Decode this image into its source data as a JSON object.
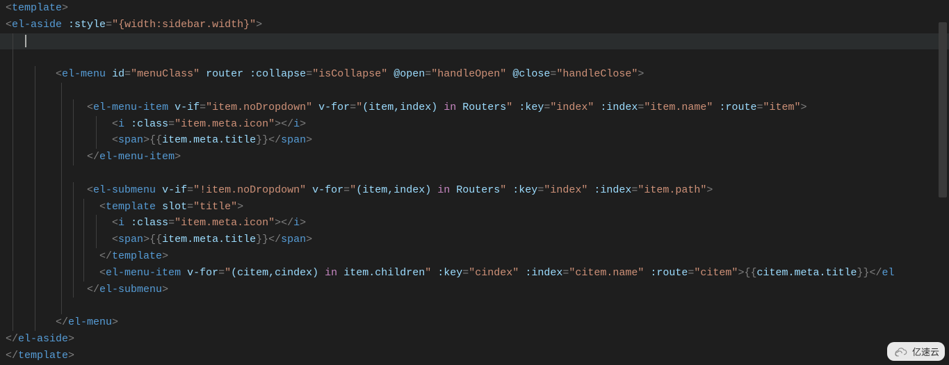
{
  "watermark": "亿速云",
  "lines": [
    {
      "guides": [],
      "segments": [
        {
          "t": "<",
          "c": "punct"
        },
        {
          "t": "template",
          "c": "tag"
        },
        {
          "t": ">",
          "c": "punct"
        }
      ]
    },
    {
      "guides": [],
      "segments": [
        {
          "t": "<",
          "c": "punct"
        },
        {
          "t": "el-aside",
          "c": "tag"
        },
        {
          "t": " ",
          "c": "txt"
        },
        {
          "t": ":style",
          "c": "attr"
        },
        {
          "t": "=",
          "c": "punct"
        },
        {
          "t": "\"{width:sidebar.width}\"",
          "c": "str"
        },
        {
          "t": ">",
          "c": "punct"
        }
      ]
    },
    {
      "guides": [
        "g1"
      ],
      "hl": true,
      "cursor": true,
      "segments": [
        {
          "t": "   ",
          "c": "txt"
        }
      ]
    },
    {
      "guides": [
        "g1"
      ],
      "segments": [
        {
          "t": "",
          "c": "txt"
        }
      ]
    },
    {
      "guides": [
        "g1",
        "g2"
      ],
      "segments": [
        {
          "t": "        ",
          "c": "txt"
        },
        {
          "t": "<",
          "c": "punct"
        },
        {
          "t": "el-menu",
          "c": "tag"
        },
        {
          "t": " ",
          "c": "txt"
        },
        {
          "t": "id",
          "c": "attr"
        },
        {
          "t": "=",
          "c": "punct"
        },
        {
          "t": "\"menuClass\"",
          "c": "str"
        },
        {
          "t": " ",
          "c": "txt"
        },
        {
          "t": "router",
          "c": "attr"
        },
        {
          "t": " ",
          "c": "txt"
        },
        {
          "t": ":collapse",
          "c": "attr"
        },
        {
          "t": "=",
          "c": "punct"
        },
        {
          "t": "\"isCollapse\"",
          "c": "str"
        },
        {
          "t": " ",
          "c": "txt"
        },
        {
          "t": "@open",
          "c": "attr"
        },
        {
          "t": "=",
          "c": "punct"
        },
        {
          "t": "\"handleOpen\"",
          "c": "str"
        },
        {
          "t": " ",
          "c": "txt"
        },
        {
          "t": "@close",
          "c": "attr"
        },
        {
          "t": "=",
          "c": "punct"
        },
        {
          "t": "\"handleClose\"",
          "c": "str"
        },
        {
          "t": ">",
          "c": "punct"
        }
      ]
    },
    {
      "guides": [
        "g1",
        "g2",
        "g3"
      ],
      "segments": [
        {
          "t": "",
          "c": "txt"
        }
      ]
    },
    {
      "guides": [
        "g1",
        "g2",
        "g3",
        "g4"
      ],
      "segments": [
        {
          "t": "             ",
          "c": "txt"
        },
        {
          "t": "<",
          "c": "punct"
        },
        {
          "t": "el-menu-item",
          "c": "tag"
        },
        {
          "t": " ",
          "c": "txt"
        },
        {
          "t": "v-if",
          "c": "attr"
        },
        {
          "t": "=",
          "c": "punct"
        },
        {
          "t": "\"item.noDropdown\"",
          "c": "str"
        },
        {
          "t": " ",
          "c": "txt"
        },
        {
          "t": "v-for",
          "c": "attr"
        },
        {
          "t": "=",
          "c": "punct"
        },
        {
          "t": "\"",
          "c": "str"
        },
        {
          "t": "(item,index) ",
          "c": "ident"
        },
        {
          "t": "in",
          "c": "key"
        },
        {
          "t": " Routers",
          "c": "ident"
        },
        {
          "t": "\"",
          "c": "str"
        },
        {
          "t": " ",
          "c": "txt"
        },
        {
          "t": ":key",
          "c": "attr"
        },
        {
          "t": "=",
          "c": "punct"
        },
        {
          "t": "\"index\"",
          "c": "str"
        },
        {
          "t": " ",
          "c": "txt"
        },
        {
          "t": ":index",
          "c": "attr"
        },
        {
          "t": "=",
          "c": "punct"
        },
        {
          "t": "\"item.name\"",
          "c": "str"
        },
        {
          "t": " ",
          "c": "txt"
        },
        {
          "t": ":route",
          "c": "attr"
        },
        {
          "t": "=",
          "c": "punct"
        },
        {
          "t": "\"item\"",
          "c": "str"
        },
        {
          "t": ">",
          "c": "punct"
        }
      ]
    },
    {
      "guides": [
        "g1",
        "g2",
        "g3",
        "g4",
        "g6"
      ],
      "segments": [
        {
          "t": "                 ",
          "c": "txt"
        },
        {
          "t": "<",
          "c": "punct"
        },
        {
          "t": "i",
          "c": "tag"
        },
        {
          "t": " ",
          "c": "txt"
        },
        {
          "t": ":class",
          "c": "attr"
        },
        {
          "t": "=",
          "c": "punct"
        },
        {
          "t": "\"item.meta.icon\"",
          "c": "str"
        },
        {
          "t": "></",
          "c": "punct"
        },
        {
          "t": "i",
          "c": "tag"
        },
        {
          "t": ">",
          "c": "punct"
        }
      ]
    },
    {
      "guides": [
        "g1",
        "g2",
        "g3",
        "g4",
        "g6"
      ],
      "segments": [
        {
          "t": "                 ",
          "c": "txt"
        },
        {
          "t": "<",
          "c": "punct"
        },
        {
          "t": "span",
          "c": "tag"
        },
        {
          "t": ">",
          "c": "punct"
        },
        {
          "t": "{{",
          "c": "punct"
        },
        {
          "t": "item.meta.title",
          "c": "ident"
        },
        {
          "t": "}}",
          "c": "punct"
        },
        {
          "t": "</",
          "c": "punct"
        },
        {
          "t": "span",
          "c": "tag"
        },
        {
          "t": ">",
          "c": "punct"
        }
      ]
    },
    {
      "guides": [
        "g1",
        "g2",
        "g3",
        "g4"
      ],
      "segments": [
        {
          "t": "             ",
          "c": "txt"
        },
        {
          "t": "</",
          "c": "punct"
        },
        {
          "t": "el-menu-item",
          "c": "tag"
        },
        {
          "t": ">",
          "c": "punct"
        }
      ]
    },
    {
      "guides": [
        "g1",
        "g2",
        "g3"
      ],
      "segments": [
        {
          "t": "",
          "c": "txt"
        }
      ]
    },
    {
      "guides": [
        "g1",
        "g2",
        "g3",
        "g4"
      ],
      "segments": [
        {
          "t": "             ",
          "c": "txt"
        },
        {
          "t": "<",
          "c": "punct"
        },
        {
          "t": "el-submenu",
          "c": "tag"
        },
        {
          "t": " ",
          "c": "txt"
        },
        {
          "t": "v-if",
          "c": "attr"
        },
        {
          "t": "=",
          "c": "punct"
        },
        {
          "t": "\"!item.noDropdown\"",
          "c": "str"
        },
        {
          "t": " ",
          "c": "txt"
        },
        {
          "t": "v-for",
          "c": "attr"
        },
        {
          "t": "=",
          "c": "punct"
        },
        {
          "t": "\"",
          "c": "str"
        },
        {
          "t": "(item,index) ",
          "c": "ident"
        },
        {
          "t": "in",
          "c": "key"
        },
        {
          "t": " Routers",
          "c": "ident"
        },
        {
          "t": "\"",
          "c": "str"
        },
        {
          "t": " ",
          "c": "txt"
        },
        {
          "t": ":key",
          "c": "attr"
        },
        {
          "t": "=",
          "c": "punct"
        },
        {
          "t": "\"index\"",
          "c": "str"
        },
        {
          "t": " ",
          "c": "txt"
        },
        {
          "t": ":index",
          "c": "attr"
        },
        {
          "t": "=",
          "c": "punct"
        },
        {
          "t": "\"item.path\"",
          "c": "str"
        },
        {
          "t": ">",
          "c": "punct"
        }
      ]
    },
    {
      "guides": [
        "g1",
        "g2",
        "g3",
        "g4",
        "g5"
      ],
      "segments": [
        {
          "t": "               ",
          "c": "txt"
        },
        {
          "t": "<",
          "c": "punct"
        },
        {
          "t": "template",
          "c": "tag"
        },
        {
          "t": " ",
          "c": "txt"
        },
        {
          "t": "slot",
          "c": "attr"
        },
        {
          "t": "=",
          "c": "punct"
        },
        {
          "t": "\"title\"",
          "c": "str"
        },
        {
          "t": ">",
          "c": "punct"
        }
      ]
    },
    {
      "guides": [
        "g1",
        "g2",
        "g3",
        "g4",
        "g5",
        "g6"
      ],
      "segments": [
        {
          "t": "                 ",
          "c": "txt"
        },
        {
          "t": "<",
          "c": "punct"
        },
        {
          "t": "i",
          "c": "tag"
        },
        {
          "t": " ",
          "c": "txt"
        },
        {
          "t": ":class",
          "c": "attr"
        },
        {
          "t": "=",
          "c": "punct"
        },
        {
          "t": "\"item.meta.icon\"",
          "c": "str"
        },
        {
          "t": "></",
          "c": "punct"
        },
        {
          "t": "i",
          "c": "tag"
        },
        {
          "t": ">",
          "c": "punct"
        }
      ]
    },
    {
      "guides": [
        "g1",
        "g2",
        "g3",
        "g4",
        "g5",
        "g6"
      ],
      "segments": [
        {
          "t": "                 ",
          "c": "txt"
        },
        {
          "t": "<",
          "c": "punct"
        },
        {
          "t": "span",
          "c": "tag"
        },
        {
          "t": ">",
          "c": "punct"
        },
        {
          "t": "{{",
          "c": "punct"
        },
        {
          "t": "item.meta.title",
          "c": "ident"
        },
        {
          "t": "}}",
          "c": "punct"
        },
        {
          "t": "</",
          "c": "punct"
        },
        {
          "t": "span",
          "c": "tag"
        },
        {
          "t": ">",
          "c": "punct"
        }
      ]
    },
    {
      "guides": [
        "g1",
        "g2",
        "g3",
        "g4",
        "g5"
      ],
      "segments": [
        {
          "t": "               ",
          "c": "txt"
        },
        {
          "t": "</",
          "c": "punct"
        },
        {
          "t": "template",
          "c": "tag"
        },
        {
          "t": ">",
          "c": "punct"
        }
      ]
    },
    {
      "guides": [
        "g1",
        "g2",
        "g3",
        "g4",
        "g5"
      ],
      "segments": [
        {
          "t": "               ",
          "c": "txt"
        },
        {
          "t": "<",
          "c": "punct"
        },
        {
          "t": "el-menu-item",
          "c": "tag"
        },
        {
          "t": " ",
          "c": "txt"
        },
        {
          "t": "v-for",
          "c": "attr"
        },
        {
          "t": "=",
          "c": "punct"
        },
        {
          "t": "\"",
          "c": "str"
        },
        {
          "t": "(citem,cindex) ",
          "c": "ident"
        },
        {
          "t": "in",
          "c": "key"
        },
        {
          "t": " item.children",
          "c": "ident"
        },
        {
          "t": "\"",
          "c": "str"
        },
        {
          "t": " ",
          "c": "txt"
        },
        {
          "t": ":key",
          "c": "attr"
        },
        {
          "t": "=",
          "c": "punct"
        },
        {
          "t": "\"cindex\"",
          "c": "str"
        },
        {
          "t": " ",
          "c": "txt"
        },
        {
          "t": ":index",
          "c": "attr"
        },
        {
          "t": "=",
          "c": "punct"
        },
        {
          "t": "\"citem.name\"",
          "c": "str"
        },
        {
          "t": " ",
          "c": "txt"
        },
        {
          "t": ":route",
          "c": "attr"
        },
        {
          "t": "=",
          "c": "punct"
        },
        {
          "t": "\"citem\"",
          "c": "str"
        },
        {
          "t": ">",
          "c": "punct"
        },
        {
          "t": "{{",
          "c": "punct"
        },
        {
          "t": "citem.meta.title",
          "c": "ident"
        },
        {
          "t": "}}",
          "c": "punct"
        },
        {
          "t": "</",
          "c": "punct"
        },
        {
          "t": "el",
          "c": "tag"
        }
      ]
    },
    {
      "guides": [
        "g1",
        "g2",
        "g3",
        "g4"
      ],
      "segments": [
        {
          "t": "             ",
          "c": "txt"
        },
        {
          "t": "</",
          "c": "punct"
        },
        {
          "t": "el-submenu",
          "c": "tag"
        },
        {
          "t": ">",
          "c": "punct"
        }
      ]
    },
    {
      "guides": [
        "g1",
        "g2",
        "g3"
      ],
      "segments": [
        {
          "t": "",
          "c": "txt"
        }
      ]
    },
    {
      "guides": [
        "g1",
        "g2"
      ],
      "segments": [
        {
          "t": "        ",
          "c": "txt"
        },
        {
          "t": "</",
          "c": "punct"
        },
        {
          "t": "el-menu",
          "c": "tag"
        },
        {
          "t": ">",
          "c": "punct"
        }
      ]
    },
    {
      "guides": [],
      "segments": [
        {
          "t": "</",
          "c": "punct"
        },
        {
          "t": "el-aside",
          "c": "tag"
        },
        {
          "t": ">",
          "c": "punct"
        }
      ]
    },
    {
      "guides": [],
      "segments": [
        {
          "t": "</",
          "c": "punct"
        },
        {
          "t": "template",
          "c": "tag"
        },
        {
          "t": ">",
          "c": "punct"
        }
      ]
    }
  ]
}
